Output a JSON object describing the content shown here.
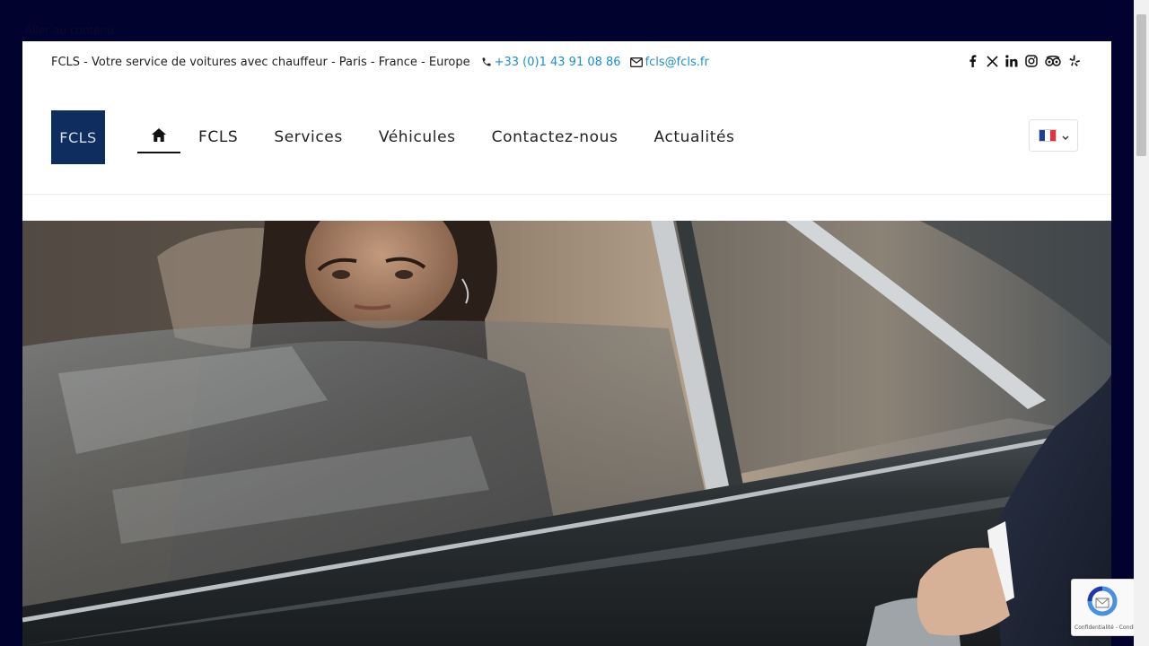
{
  "skip_link": "Aller au contenu",
  "topbar": {
    "tagline": "FCLS - Votre service de voitures avec chauffeur - Paris - France - Europe",
    "phone": "+33 (0)1 43 91 08 86",
    "email": "fcls@fcls.fr",
    "socials": [
      "facebook-icon",
      "x-twitter-icon",
      "linkedin-icon",
      "instagram-icon",
      "tripadvisor-icon",
      "yelp-icon"
    ]
  },
  "header": {
    "logo_text": "FCLS",
    "nav": {
      "home_icon": "home-icon",
      "items": [
        "FCLS",
        "Services",
        "Véhicules",
        "Contactez-nous",
        "Actualités"
      ]
    },
    "language": {
      "selected": "fr",
      "flag_colors": [
        "#1f3f93",
        "#ffffff",
        "#e0333b"
      ]
    }
  },
  "hero": {
    "image": "woman-in-car-chauffeur-opening-door"
  },
  "recaptcha": {
    "text": "Confidentialité - Conditions"
  },
  "colors": {
    "page_bg": "#02022e",
    "link": "#1a8fd0",
    "logo_bg": "#0f2d5e"
  }
}
